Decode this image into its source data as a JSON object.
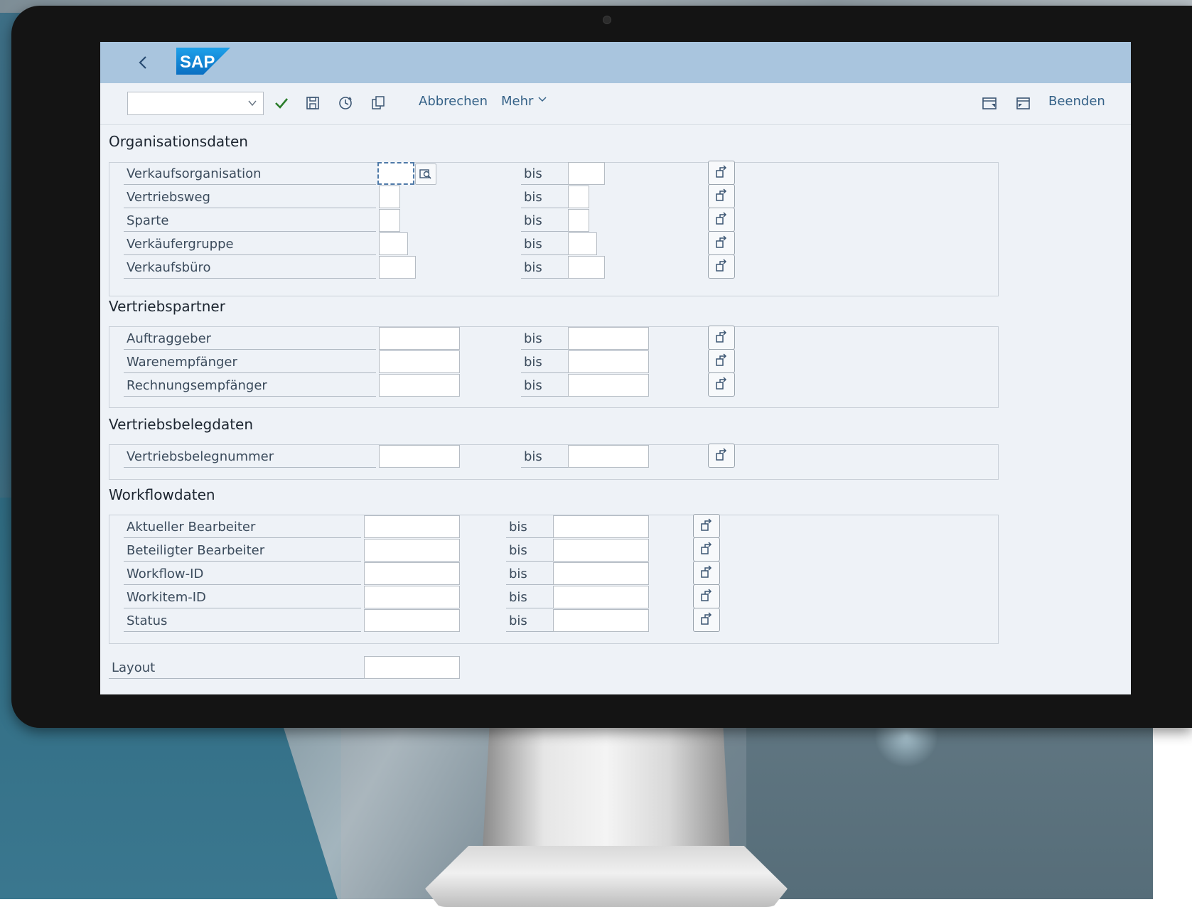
{
  "toolbar": {
    "command_field_value": "",
    "abbrechen_label": "Abbrechen",
    "mehr_label": "Mehr",
    "beenden_label": "Beenden",
    "icons": [
      "back-icon",
      "sap-logo",
      "check-icon",
      "save-icon",
      "clock-icon",
      "copy-icon",
      "window-icon",
      "window-restore-icon"
    ],
    "check_color": "#2b7d2b"
  },
  "sections": {
    "org": {
      "title": "Organisationsdaten",
      "rows": [
        {
          "label": "Verkaufsorganisation",
          "bis": "bis"
        },
        {
          "label": "Vertriebsweg",
          "bis": "bis"
        },
        {
          "label": "Sparte",
          "bis": "bis"
        },
        {
          "label": "Verkäufergruppe",
          "bis": "bis"
        },
        {
          "label": "Verkaufsbüro",
          "bis": "bis"
        }
      ]
    },
    "partner": {
      "title": "Vertriebspartner",
      "rows": [
        {
          "label": "Auftraggeber",
          "bis": "bis"
        },
        {
          "label": "Warenempfänger",
          "bis": "bis"
        },
        {
          "label": "Rechnungsempfänger",
          "bis": "bis"
        }
      ]
    },
    "beleg": {
      "title": "Vertriebsbelegdaten",
      "rows": [
        {
          "label": "Vertriebsbelegnummer",
          "bis": "bis"
        }
      ]
    },
    "workflow": {
      "title": "Workflowdaten",
      "rows": [
        {
          "label": "Aktueller Bearbeiter",
          "bis": "bis"
        },
        {
          "label": "Beteiligter Bearbeiter",
          "bis": "bis"
        },
        {
          "label": "Workflow-ID",
          "bis": "bis"
        },
        {
          "label": "Workitem-ID",
          "bis": "bis"
        },
        {
          "label": "Status",
          "bis": "bis"
        }
      ]
    }
  },
  "layout_field": {
    "label": "Layout",
    "value": ""
  },
  "colors": {
    "shellbar": "#a9c5de",
    "screen": "#eef2f7",
    "link": "#346187",
    "bezel": "#141414"
  }
}
